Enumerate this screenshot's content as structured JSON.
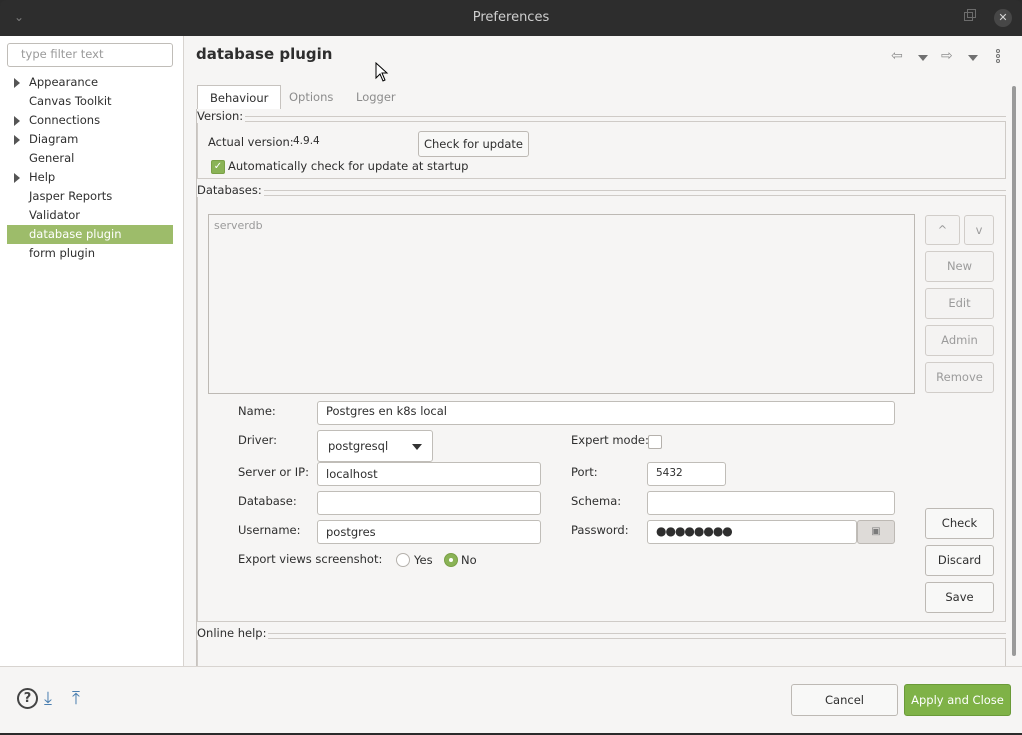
{
  "window": {
    "title": "Preferences"
  },
  "sidebar": {
    "filter_placeholder": "type filter text",
    "items": [
      {
        "label": "Appearance",
        "expandable": true
      },
      {
        "label": "Canvas Toolkit",
        "expandable": false
      },
      {
        "label": "Connections",
        "expandable": true
      },
      {
        "label": "Diagram",
        "expandable": true
      },
      {
        "label": "General",
        "expandable": false
      },
      {
        "label": "Help",
        "expandable": true
      },
      {
        "label": "Jasper Reports",
        "expandable": false
      },
      {
        "label": "Validator",
        "expandable": false
      },
      {
        "label": "database plugin",
        "expandable": false,
        "selected": true
      },
      {
        "label": "form plugin",
        "expandable": false
      }
    ]
  },
  "page": {
    "title": "database plugin",
    "tabs": [
      "Behaviour",
      "Options",
      "Logger"
    ],
    "active_tab": "Behaviour"
  },
  "version": {
    "group_label": "Version:",
    "actual_label": "Actual version:",
    "actual_value": "4.9.4",
    "check_update_label": "Check for update",
    "auto_check_label": "Automatically check for update at startup",
    "auto_check": true
  },
  "databases": {
    "group_label": "Databases:",
    "items": [
      "serverdb"
    ],
    "up_label": "^",
    "down_label": "v",
    "new_label": "New",
    "edit_label": "Edit",
    "admin_label": "Admin",
    "remove_label": "Remove"
  },
  "form": {
    "name_label": "Name:",
    "name_value": "Postgres en k8s local",
    "driver_label": "Driver:",
    "driver_value": "postgresql",
    "expert_label": "Expert mode:",
    "expert_mode": false,
    "server_label": "Server or IP:",
    "server_value": "localhost",
    "port_label": "Port:",
    "port_value": "5432",
    "database_label": "Database:",
    "database_value": "",
    "schema_label": "Schema:",
    "schema_value": "",
    "username_label": "Username:",
    "username_value": "postgres",
    "password_label": "Password:",
    "password_value": "●●●●●●●●",
    "export_label": "Export views screenshot:",
    "export_yes": "Yes",
    "export_no": "No",
    "export_selected": "No",
    "check_label": "Check",
    "discard_label": "Discard",
    "save_label": "Save"
  },
  "online_help": {
    "group_label": "Online help:"
  },
  "footer": {
    "cancel_label": "Cancel",
    "apply_label": "Apply and Close",
    "help_glyph": "?"
  },
  "colors": {
    "selection": "#9dbc6a",
    "primary_button": "#7fb247",
    "titlebar": "#2d2d2d"
  }
}
